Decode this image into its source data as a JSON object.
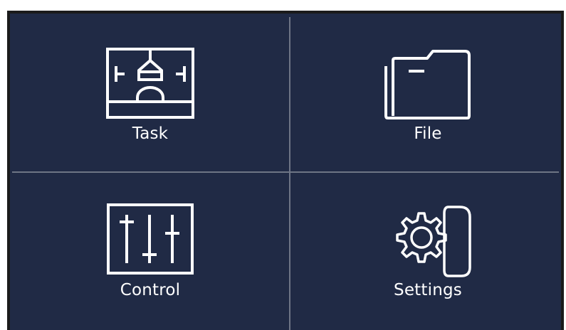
{
  "menu": {
    "tiles": [
      {
        "label": "Task",
        "icon": "printer-icon"
      },
      {
        "label": "File",
        "icon": "folder-icon"
      },
      {
        "label": "Control",
        "icon": "sliders-icon"
      },
      {
        "label": "Settings",
        "icon": "gear-icon"
      }
    ]
  },
  "colors": {
    "background": "#202a45",
    "divider": "#6e7585",
    "foreground": "#ffffff",
    "bezel": "#1b1b1b"
  }
}
